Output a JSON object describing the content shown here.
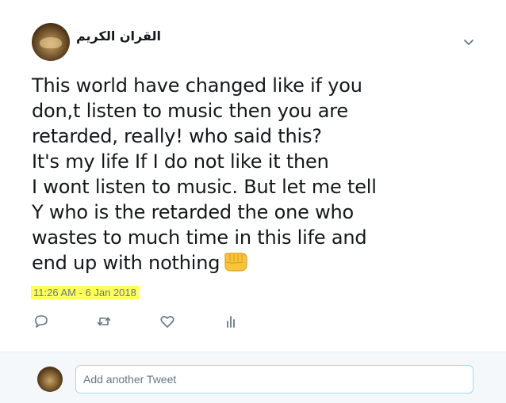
{
  "tweet": {
    "author_name": "القران الكريم",
    "text": "This world have changed like if you\ndon,t listen to music then you are\nretarded, really! who said this?\nIt's my life If I do not like it then\nI wont listen to music. But let me tell\nY who is the retarded the one who\nwastes to much time in this life and\nend up with nothing",
    "emoji": "oncoming-fist-emoji",
    "timestamp": "11:26 AM - 6 Jan 2018",
    "highlight_color": "#ffff59"
  },
  "actions": [
    {
      "icon": "reply-icon"
    },
    {
      "icon": "retweet-icon"
    },
    {
      "icon": "like-icon"
    },
    {
      "icon": "analytics-icon"
    }
  ],
  "reply_box": {
    "placeholder": "Add another Tweet"
  },
  "colors": {
    "icon_gray": "#657786",
    "input_border": "#a4d9f9",
    "reply_bg": "#f5f8fa"
  }
}
